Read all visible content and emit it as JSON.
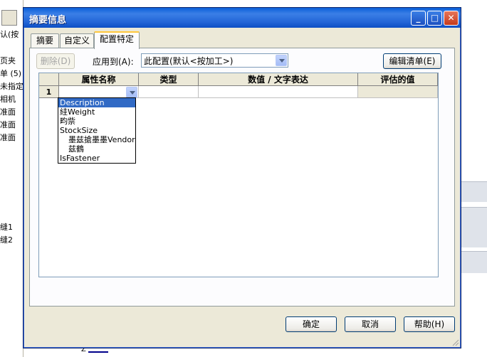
{
  "background": {
    "left_items": [
      "认(按",
      "页夹",
      "单 (5)",
      "未指定",
      "相机",
      "准面",
      "准面",
      "准面",
      "缝1",
      "缝2"
    ],
    "axis_label": "Z"
  },
  "dialog": {
    "title": "摘要信息",
    "tabs": [
      "摘要",
      "自定义",
      "配置特定"
    ],
    "active_tab": "配置特定",
    "delete_button": "删除(D)",
    "apply_to_label": "应用到(A):",
    "apply_to_value": "此配置(默认<按加工>)",
    "edit_list_button": "编辑清单(E)",
    "table": {
      "headers": [
        "属性名称",
        "类型",
        "数值 / 文字表达",
        "评估的值"
      ],
      "rows": [
        {
          "num": "1",
          "name": "",
          "type": "",
          "value": "",
          "evaluated": ""
        }
      ]
    },
    "dropdown_options": [
      "Description",
      "絓Weight",
      "畇祡",
      "StockSize",
      "墨兹搶墨墨Vendor",
      "兹鶴",
      "IsFastener"
    ],
    "dropdown_selected": "Description",
    "ok_button": "确定",
    "cancel_button": "取消",
    "help_button": "帮助(H)"
  },
  "colors": {
    "titlebar": "#2466d8",
    "selection": "#316ac5",
    "dialog_bg": "#ece9d8"
  }
}
